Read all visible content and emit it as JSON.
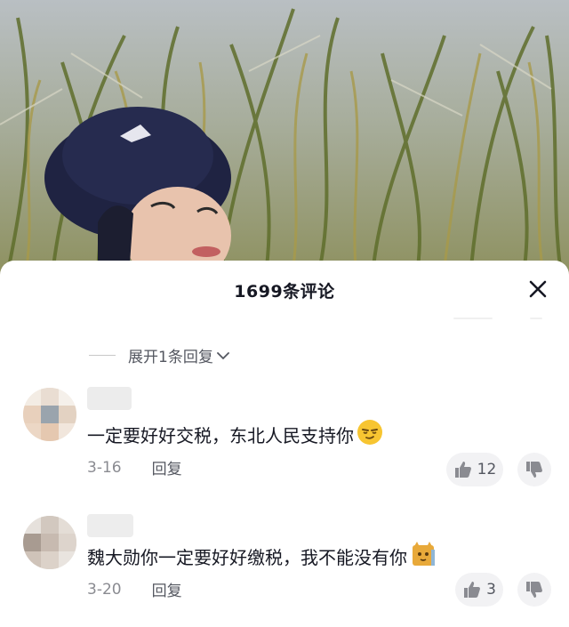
{
  "sheet": {
    "title": "1699条评论",
    "expand_replies_label": "展开1条回复"
  },
  "comments": [
    {
      "text": "一定要好好交税，东北人民支持你",
      "emoji": "smirk-emoji",
      "date": "3-16",
      "reply_label": "回复",
      "like_count": "12"
    },
    {
      "text": "魏大勋你一定要好好缴税，我不能没有你",
      "emoji": "cat-emoji",
      "date": "3-20",
      "reply_label": "回复",
      "like_count": "3"
    }
  ],
  "colors": {
    "text_primary": "#161823",
    "text_secondary": "#8a8b91",
    "pill_bg": "#f2f2f4"
  }
}
